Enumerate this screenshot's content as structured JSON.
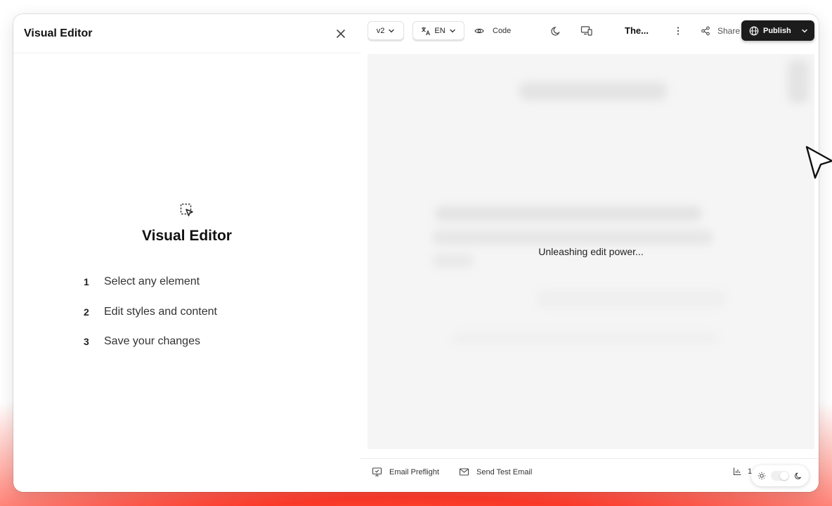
{
  "left_panel": {
    "title": "Visual Editor",
    "close_icon": "close-icon",
    "hero": {
      "icon": "selection-cursor-icon",
      "title": "Visual Editor"
    },
    "steps": [
      {
        "num": "1",
        "label": "Select any element"
      },
      {
        "num": "2",
        "label": "Edit styles and content"
      },
      {
        "num": "3",
        "label": "Save your changes"
      }
    ]
  },
  "toolbar": {
    "version": "v2",
    "language": "EN",
    "code_label": "Code",
    "theme_title": "The...",
    "share_label": "Share",
    "publish_label": "Publish"
  },
  "preview": {
    "loading_text": "Unleashing edit power..."
  },
  "footer": {
    "email_preflight": "Email Preflight",
    "send_test_email": "Send Test Email",
    "zoom": "14."
  },
  "colors": {
    "publish_bg": "#1c1c1c",
    "preview_bg": "#f5f5f5",
    "gradient_red": "#ff3a2a",
    "gradient_orange": "#ff7a1a"
  }
}
